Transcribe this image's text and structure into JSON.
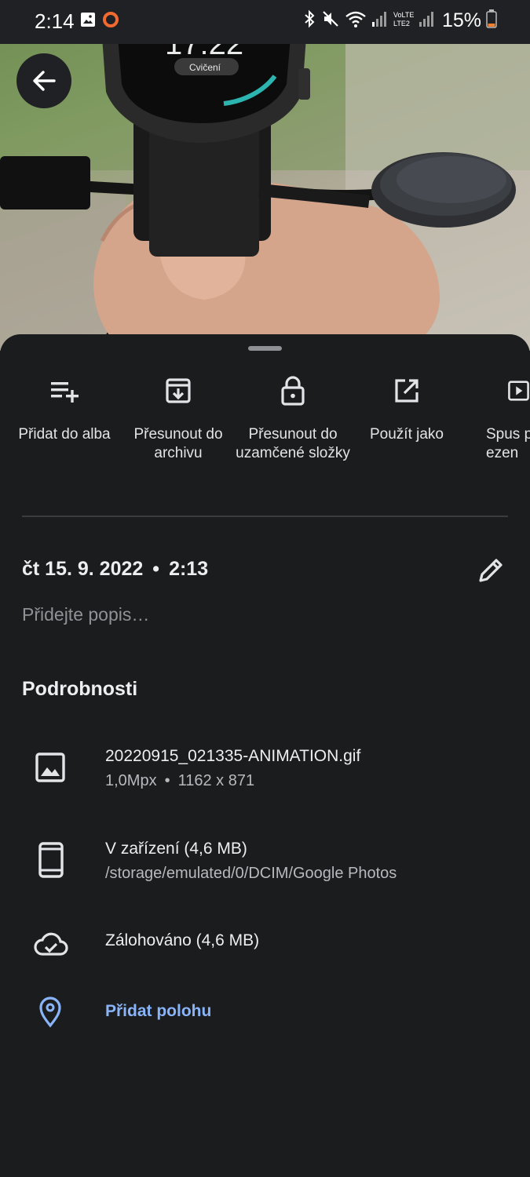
{
  "status_bar": {
    "time": "2:14",
    "battery_percent": "15%"
  },
  "colors": {
    "background": "#1b1c1e",
    "link": "#8ab4f8",
    "muted_text": "#8f9196"
  },
  "photo": {
    "watch_time": "17:22",
    "watch_label": "Cvičení"
  },
  "actions": [
    {
      "icon": "playlist-add-icon",
      "label": "Přidat do alba"
    },
    {
      "icon": "archive-icon",
      "label": "Přesunout do archivu"
    },
    {
      "icon": "lock-icon",
      "label": "Přesunout do uzamčené složky"
    },
    {
      "icon": "open-in-new-icon",
      "label": "Použít jako"
    },
    {
      "icon": "slideshow-icon",
      "label": "Spus prezen"
    }
  ],
  "date": "čt 15. 9. 2022",
  "time": "2:13",
  "description_placeholder": "Přidejte popis…",
  "details_heading": "Podrobnosti",
  "details": {
    "file": {
      "name": "20220915_021335-ANIMATION.gif",
      "megapixels": "1,0Mpx",
      "resolution": "1162 x 871"
    },
    "device": {
      "title": "V zařízení (4,6 MB)",
      "path": "/storage/emulated/0/DCIM/Google Photos"
    },
    "backup": {
      "title": "Zálohováno (4,6 MB)"
    },
    "location": {
      "label": "Přidat polohu"
    }
  }
}
